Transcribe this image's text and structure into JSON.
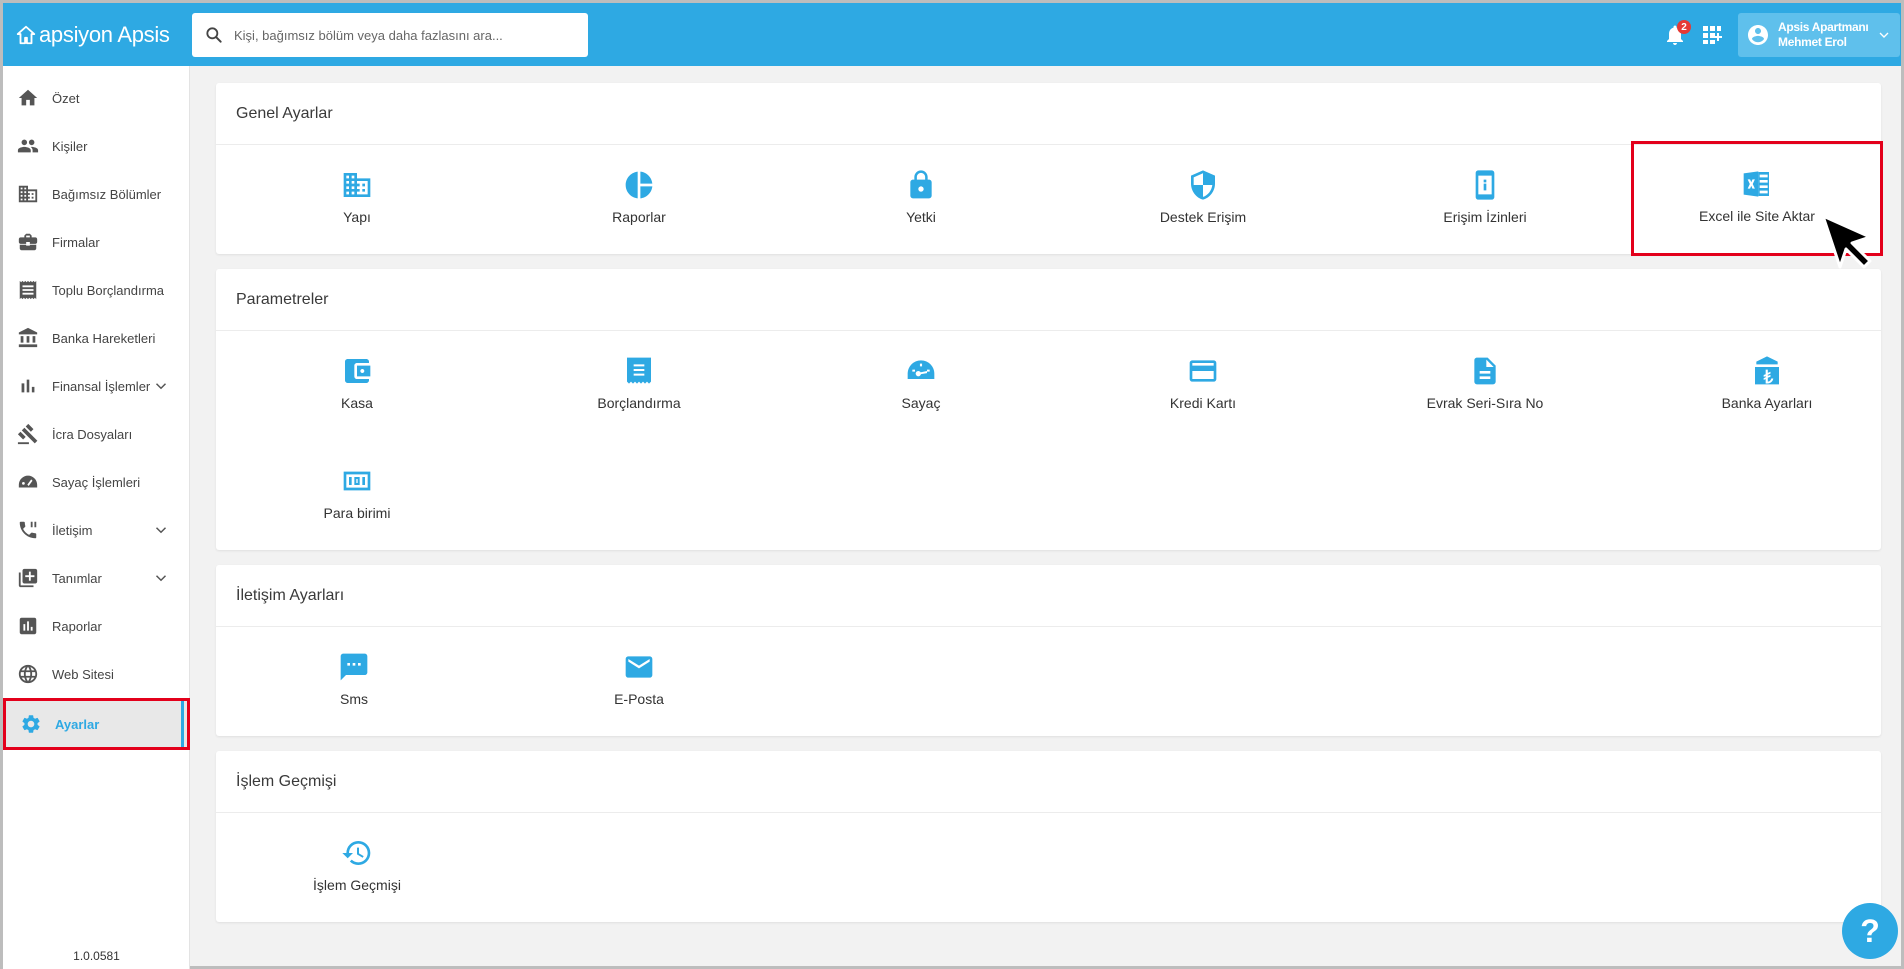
{
  "header": {
    "logo_text": "apsiyon Apsis",
    "search_placeholder": "Kişi, bağımsız bölüm veya daha fazlasını ara...",
    "notification_count": "2",
    "user_line1": "Apsis Apartmanı",
    "user_line2": "Mehmet Erol"
  },
  "sidebar": {
    "items": [
      {
        "label": "Özet",
        "icon": "home-icon"
      },
      {
        "label": "Kişiler",
        "icon": "people-icon"
      },
      {
        "label": "Bağımsız Bölümler",
        "icon": "building-icon"
      },
      {
        "label": "Firmalar",
        "icon": "briefcase-icon"
      },
      {
        "label": "Toplu Borçlandırma",
        "icon": "receipt-icon"
      },
      {
        "label": "Banka Hareketleri",
        "icon": "bank-icon"
      },
      {
        "label": "Finansal İşlemler",
        "icon": "bar-chart-icon"
      },
      {
        "label": "İcra Dosyaları",
        "icon": "gavel-icon"
      },
      {
        "label": "Sayaç İşlemleri",
        "icon": "meter-icon"
      },
      {
        "label": "İletişim",
        "icon": "phone-icon"
      },
      {
        "label": "Tanımlar",
        "icon": "add-box-icon"
      },
      {
        "label": "Raporlar",
        "icon": "report-icon"
      },
      {
        "label": "Web Sitesi",
        "icon": "globe-icon"
      },
      {
        "label": "Ayarlar",
        "icon": "gear-icon"
      }
    ],
    "version": "1.0.0581"
  },
  "sections": {
    "genel": {
      "title": "Genel Ayarlar",
      "tiles": [
        "Yapı",
        "Raporlar",
        "Yetki",
        "Destek Erişim",
        "Erişim İzinleri",
        "Excel ile Site Aktar"
      ]
    },
    "parametreler": {
      "title": "Parametreler",
      "tiles": [
        "Kasa",
        "Borçlandırma",
        "Sayaç",
        "Kredi Kartı",
        "Evrak Seri-Sıra No",
        "Banka Ayarları",
        "Para birimi"
      ]
    },
    "iletisim": {
      "title": "İletişim Ayarları",
      "tiles": [
        "Sms",
        "E-Posta"
      ]
    },
    "islem": {
      "title": "İşlem Geçmişi",
      "tiles": [
        "İşlem Geçmişi"
      ]
    }
  },
  "help_label": "?",
  "colors": {
    "brand": "#2ea9e3",
    "highlight": "#e3001b"
  }
}
